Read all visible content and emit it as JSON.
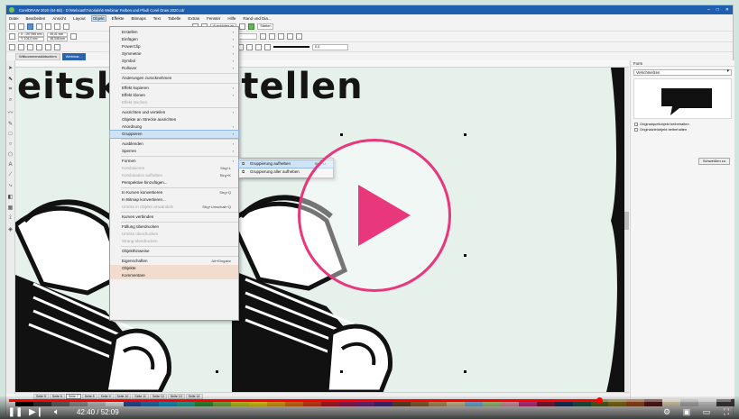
{
  "window": {
    "title": "CorelDRAW 2020 (64-Bit) - D:\\Webcast\\Tutorials\\6 Webinar Farben und Pfad\\ Corel Draw 2020.cdr",
    "controls": [
      "–",
      "□",
      "✕"
    ]
  },
  "menubar": [
    "Datei",
    "Bearbeiten",
    "Ansicht",
    "Layout",
    "Objekt",
    "Effekte",
    "Bitmaps",
    "Text",
    "Tabelle",
    "Extras",
    "Fenster",
    "Hilfe",
    "Rand und Dia..."
  ],
  "menubar_active": "Objekt",
  "toolbar": {
    "align_label": "Ausrichten an",
    "start_label": "Starten",
    "x_value": "X: -197,995 mm",
    "y_value": "Y: 104,0 mm",
    "w_value": "49,41 mm",
    "h_value": "46,346 mm",
    "outline_value": "0,0"
  },
  "document_tabs": [
    "Willkommensbildschirm",
    "Webinar..."
  ],
  "canvas": {
    "headline": "eitsk     n erstellen"
  },
  "objekt_menu": [
    {
      "label": "Erstellen",
      "arrow": true
    },
    {
      "label": "Einfügen",
      "arrow": true
    },
    {
      "label": "PowerClip",
      "arrow": true
    },
    {
      "label": "Symmetrie",
      "arrow": true
    },
    {
      "label": "Symbol",
      "arrow": true
    },
    {
      "label": "Rollover",
      "arrow": true
    },
    {
      "sep": true
    },
    {
      "label": "Änderungen zurücknehmen"
    },
    {
      "sep": true
    },
    {
      "label": "Effekt kopieren",
      "arrow": true
    },
    {
      "label": "Effekt klonen",
      "arrow": true
    },
    {
      "label": "Effekt löschen",
      "disabled": true
    },
    {
      "sep": true
    },
    {
      "label": "Ausrichten und verteilen",
      "arrow": true
    },
    {
      "label": "Objekte an Strecke ausrichten"
    },
    {
      "label": "Anordnung",
      "arrow": true
    },
    {
      "label": "Gruppieren",
      "arrow": true,
      "highlight": true
    },
    {
      "sep": true
    },
    {
      "label": "Ausblenden",
      "arrow": true
    },
    {
      "label": "Sperren",
      "arrow": true
    },
    {
      "sep": true
    },
    {
      "label": "Formen",
      "arrow": true
    },
    {
      "label": "Kombinieren",
      "disabled": true,
      "shortcut": "Strg+L"
    },
    {
      "label": "Kombination aufheben",
      "disabled": true,
      "shortcut": "Strg+K"
    },
    {
      "label": "Perspektive hinzufügen..."
    },
    {
      "sep": true
    },
    {
      "label": "In Kurven konvertieren",
      "shortcut": "Strg+Q"
    },
    {
      "label": "In Bitmap konvertieren..."
    },
    {
      "label": "Umriss in Objekt umwandeln",
      "disabled": true,
      "shortcut": "Strg+Umschalt+Q"
    },
    {
      "sep": true
    },
    {
      "label": "Kurven verbinden"
    },
    {
      "sep": true
    },
    {
      "label": "Füllung überdrucken"
    },
    {
      "label": "Umriss überdrucken",
      "disabled": true
    },
    {
      "label": "Strang überdrucken",
      "disabled": true
    },
    {
      "sep": true
    },
    {
      "label": "Objekthinweise"
    },
    {
      "sep": true
    },
    {
      "label": "Eigenschaften",
      "shortcut": "Alt+Eingabe"
    },
    {
      "label": "Objekte",
      "highlight_soft": true
    },
    {
      "label": "Kommentare",
      "highlight_soft": true
    }
  ],
  "gruppieren_menu": [
    {
      "label": "Gruppierung aufheben",
      "shortcut": "Strg+U",
      "highlight": true
    },
    {
      "label": "Gruppierung aller aufheben"
    }
  ],
  "docker": {
    "title": "Form",
    "mode": "Verschmelzen",
    "options": [
      "Originalquellobjekt beibehalten",
      "Originalzielobjekt beibehalten"
    ],
    "button": "Schweißen zu"
  },
  "page_tabs": [
    "Seite 5",
    "Seite 6",
    "Seite 7",
    "Seite 8",
    "Seite 9",
    "Seite 10",
    "Seite 11",
    "Seite 12",
    "Seite 13",
    "Seite 14"
  ],
  "page_tabs_active": "Seite 7",
  "palette": [
    "#000000",
    "#3b3b3b",
    "#6f6f6f",
    "#a0a0a0",
    "#d6d6d6",
    "#ffffff",
    "#2f57a4",
    "#2d7ac0",
    "#1ea3d9",
    "#30b7a6",
    "#3c9c3b",
    "#86c14a",
    "#d7df27",
    "#f8e21b",
    "#f6b21b",
    "#ef7d1e",
    "#e5481f",
    "#c7202a",
    "#a51f5c",
    "#7b2d86",
    "#4d2e83",
    "#6c4a2b",
    "#9c6b3b",
    "#c8a06b",
    "#e9d2a4",
    "#83c6e9",
    "#b6d98a",
    "#f2a7b8",
    "#d33b8c",
    "#8b1d3a",
    "#1c3764",
    "#205c48",
    "#5b6b21",
    "#8c7a1c",
    "#a3501e",
    "#5a1d1d",
    "#f0e6c8",
    "#c0c0c0",
    "#e0e0e0",
    "#404040"
  ],
  "player": {
    "time_current": "42:40",
    "time_total": "52:09",
    "time_text": "42:40 / 52:09",
    "progress": 0.818,
    "accent": "#ff0000",
    "play_color": "#e8377a"
  },
  "icons": {
    "play": "play-icon",
    "next": "next-icon",
    "volume": "volume-icon",
    "settings": "gear-icon",
    "miniplayer": "miniplayer-icon",
    "theater": "theater-icon",
    "fullscreen": "fullscreen-icon"
  }
}
